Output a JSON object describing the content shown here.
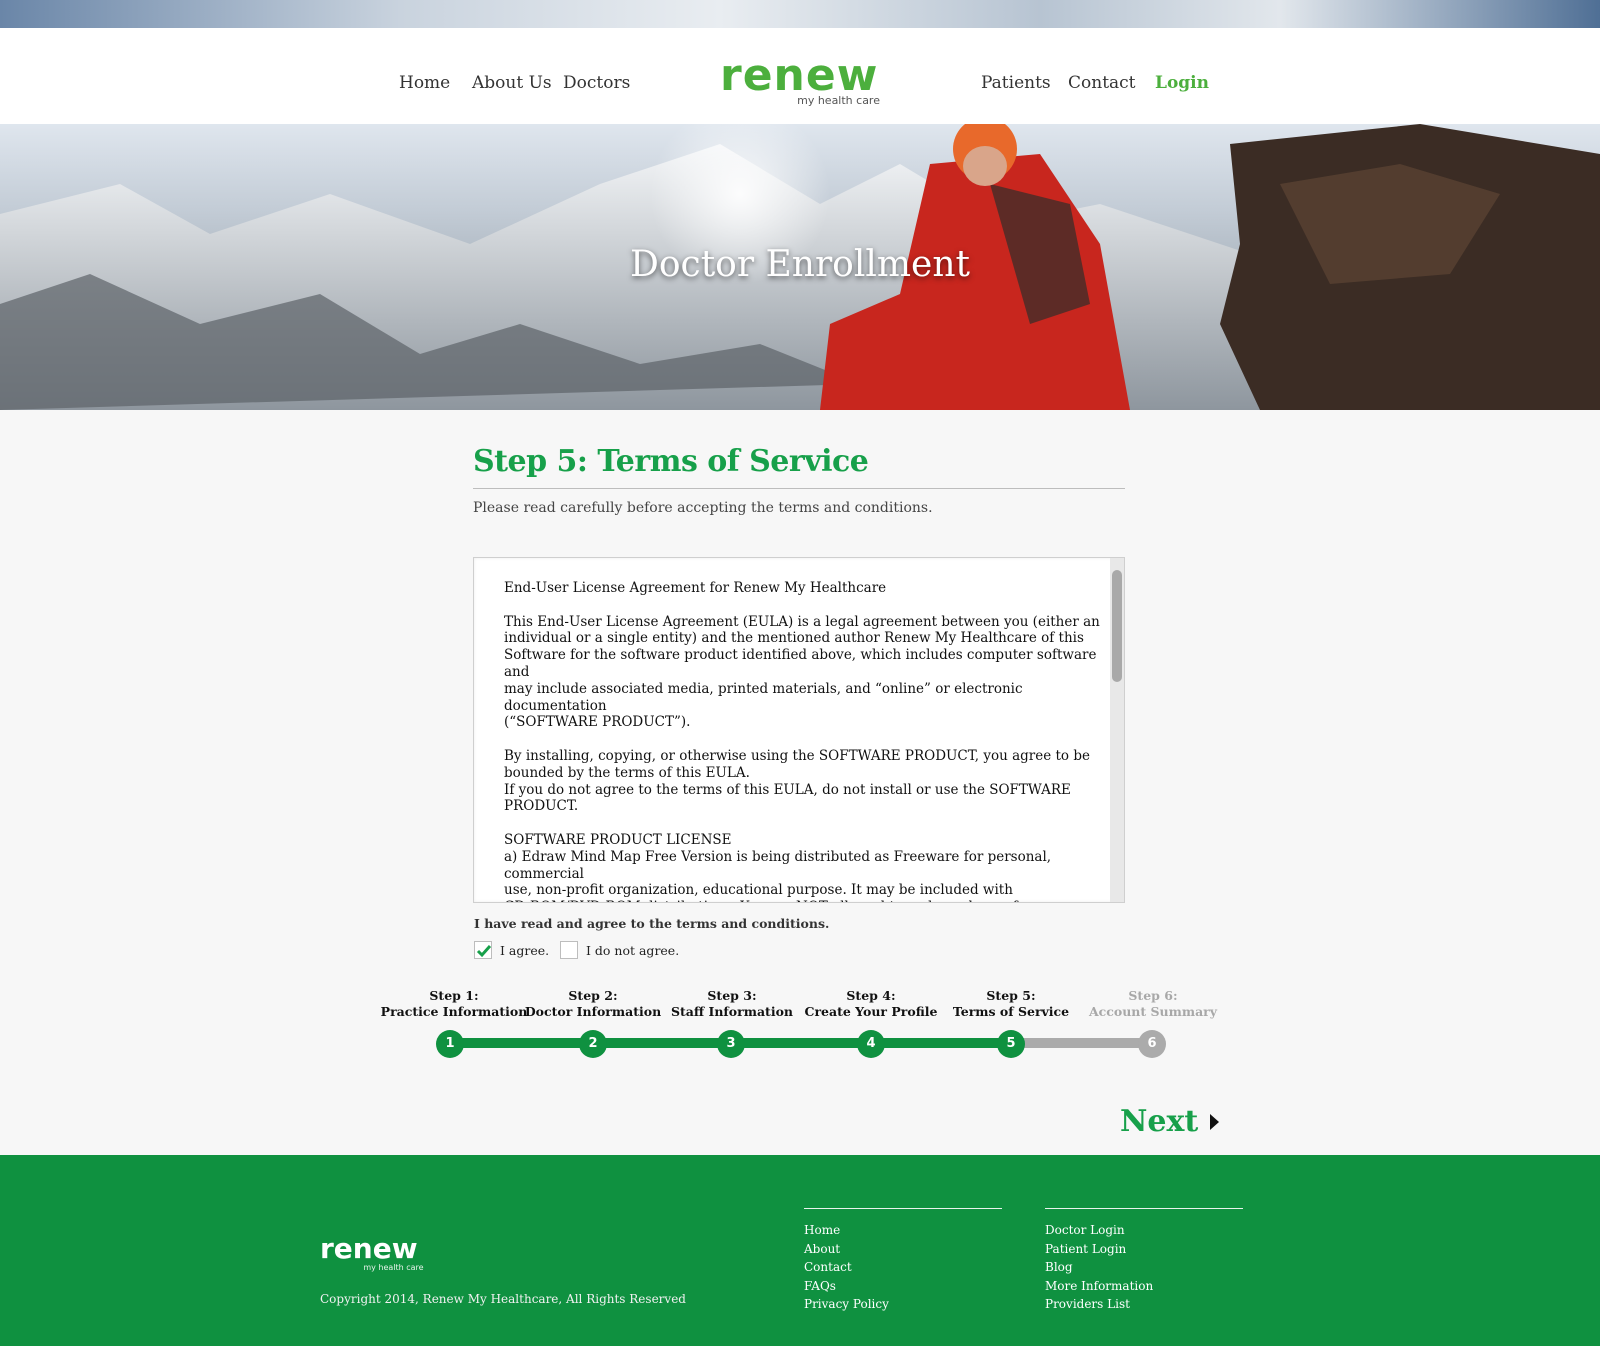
{
  "nav": {
    "home": "Home",
    "about": "About Us",
    "doctors": "Doctors",
    "patients": "Patients",
    "contact": "Contact",
    "login": "Login"
  },
  "brand": {
    "name": "renew",
    "tagline": "my health care",
    "green": "#4caf3d"
  },
  "hero": {
    "title": "Doctor Enrollment"
  },
  "step": {
    "title": "Step 5: Terms of Service",
    "subtitle": "Please read carefully before accepting the terms and conditions."
  },
  "eula": {
    "paragraphs": [
      "End-User License Agreement for Renew My Healthcare",
      "This End-User License Agreement (EULA) is a legal agreement between you (either an\nindividual or a single entity) and the mentioned author Renew My Healthcare of this\nSoftware for the software product identified above, which includes computer software and\nmay include associated media, printed materials, and “online” or electronic documentation\n(“SOFTWARE PRODUCT”).",
      "By installing, copying, or otherwise using the SOFTWARE PRODUCT, you agree to be\nbounded by the terms of this EULA.\nIf you do not agree to the terms of this EULA, do not install or use the SOFTWARE\nPRODUCT.",
      "SOFTWARE PRODUCT LICENSE\na) Edraw Mind Map Free Version is being distributed as Freeware for personal, commercial\nuse, non-profit organization, educational purpose. It may be included with\nCD-ROM/DVD-ROM distributions. You are NOT allowed to make a charge for distributing\nthis Software (either for profit or merely to recover your media and distribution costs)"
    ]
  },
  "agreement": {
    "label": "I have read and agree to the terms and conditions.",
    "agree": "I agree.",
    "disagree": "I do not agree.",
    "agree_checked": true,
    "disagree_checked": false
  },
  "progress": {
    "current": 5,
    "active_color": "#0f9140",
    "inactive_color": "#ababab",
    "steps": [
      {
        "step": "Step 1:",
        "name": "Practice Information",
        "number": "1"
      },
      {
        "step": "Step 2:",
        "name": "Doctor Information",
        "number": "2"
      },
      {
        "step": "Step 3:",
        "name": "Staff Information",
        "number": "3"
      },
      {
        "step": "Step 4:",
        "name": "Create Your Profile",
        "number": "4"
      },
      {
        "step": "Step 5:",
        "name": "Terms of Service",
        "number": "5"
      },
      {
        "step": "Step 6:",
        "name": "Account Summary",
        "number": "6"
      }
    ]
  },
  "next_label": "Next",
  "footer": {
    "brand": "renew",
    "tagline": "my health care",
    "copyright": "Copyright 2014, Renew My Healthcare, All Rights Reserved",
    "col1": [
      "Home",
      "About",
      "Contact",
      "FAQs",
      "Privacy Policy"
    ],
    "col2": [
      "Doctor Login",
      "Patient Login",
      "Blog",
      "More Information",
      "Providers List"
    ],
    "bg_color": "#0f9140"
  }
}
